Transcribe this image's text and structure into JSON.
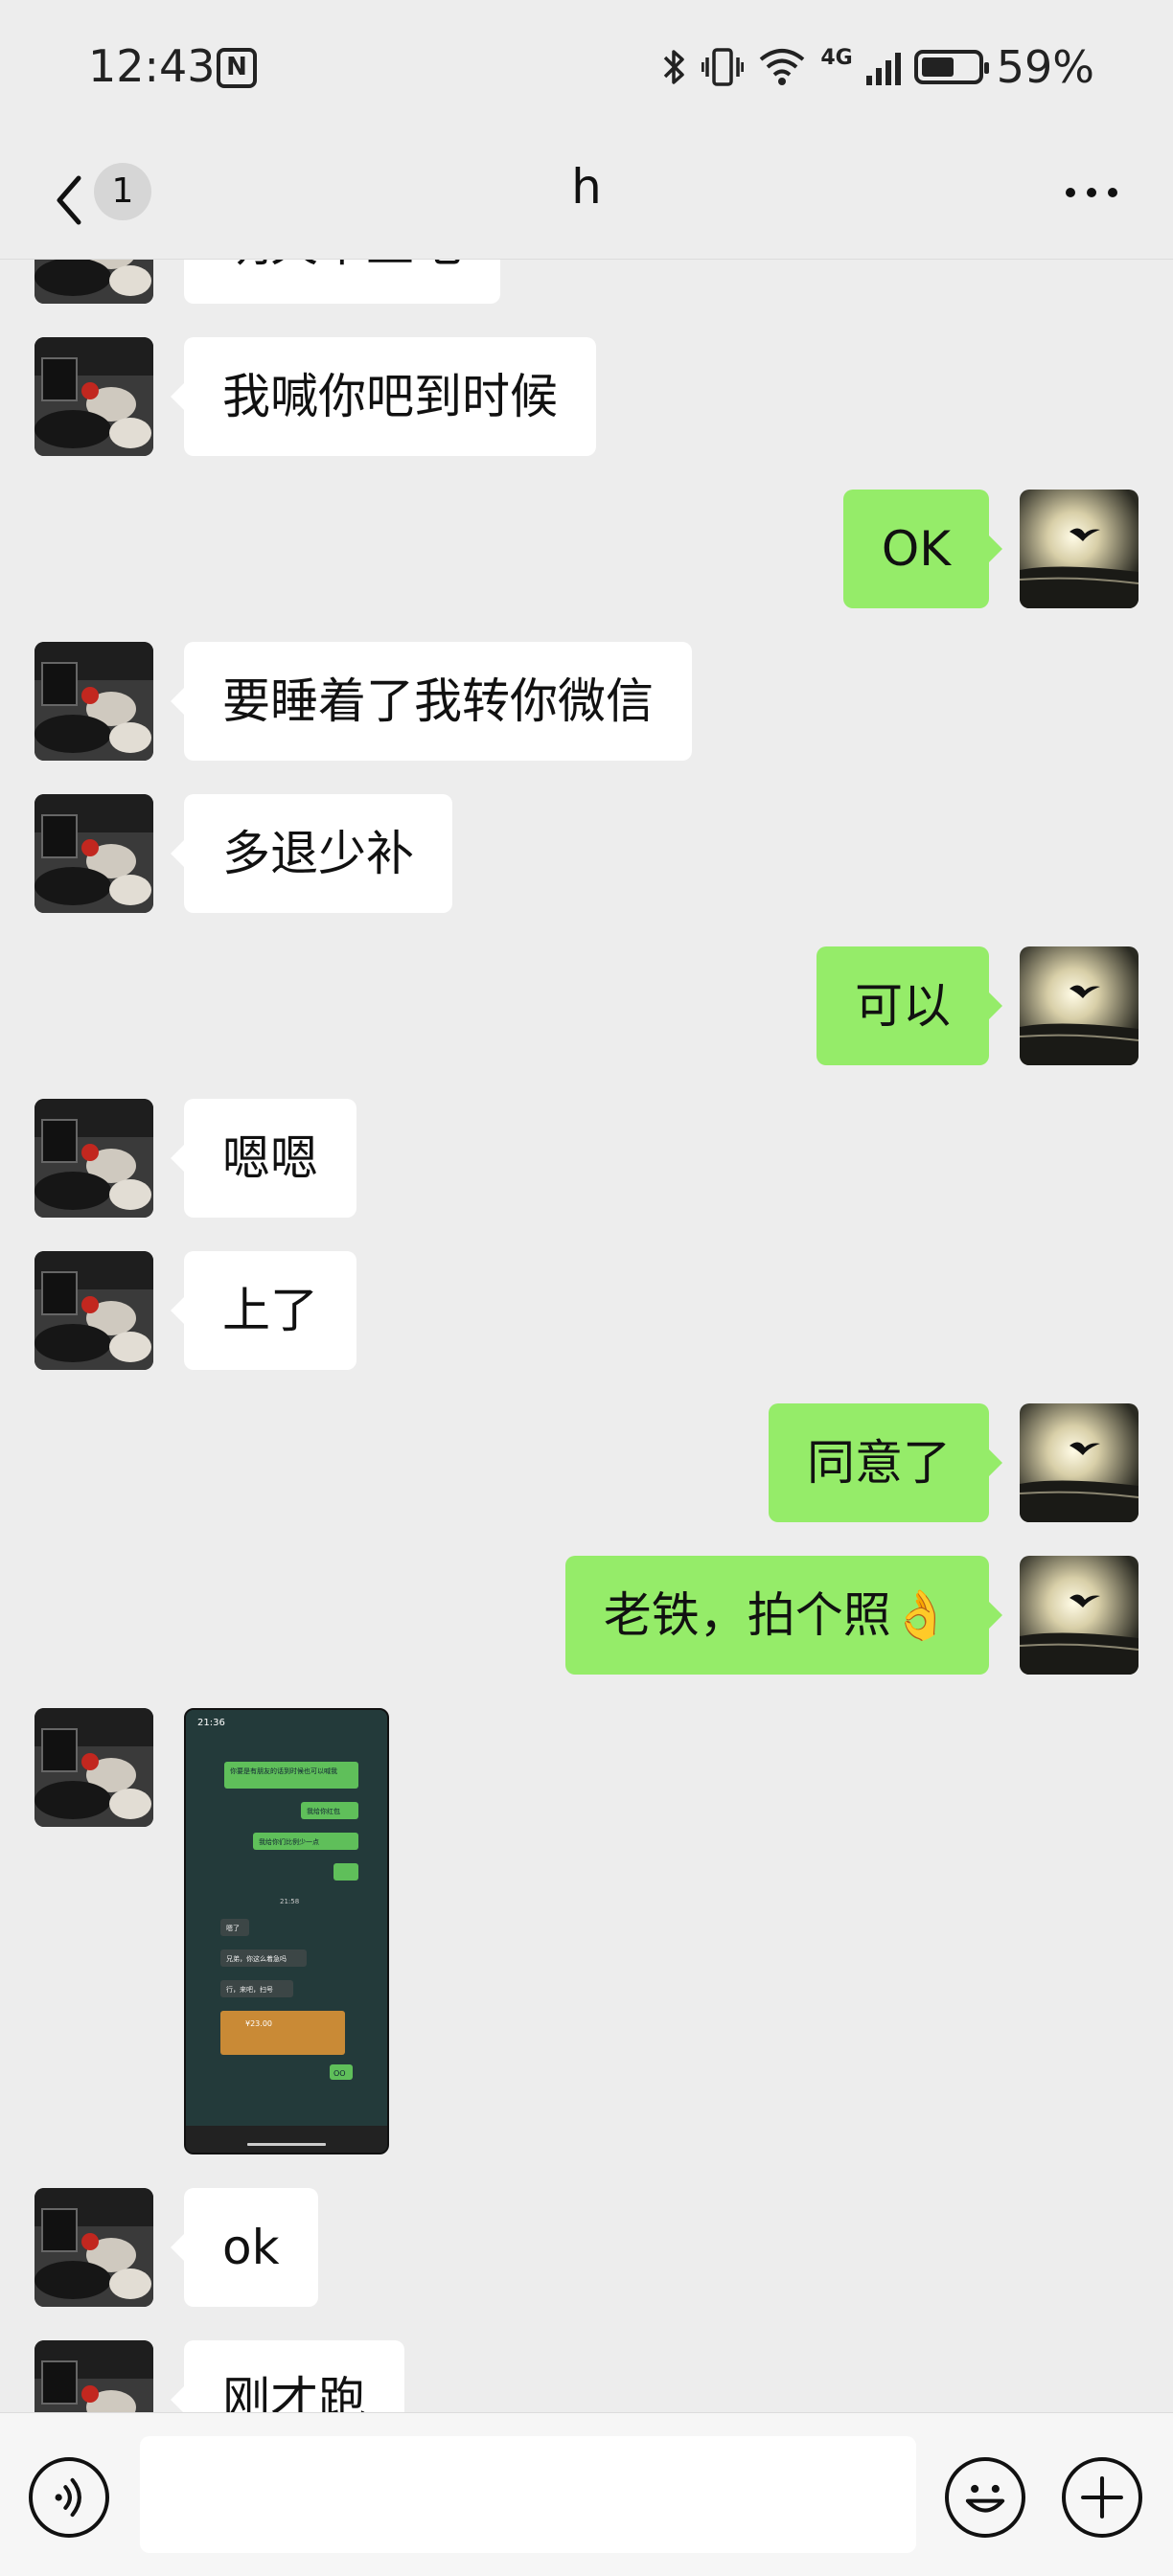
{
  "status_bar": {
    "time": "12:43",
    "nfc_label": "N",
    "network_type": "4G",
    "battery_percent": "59%",
    "battery_level": 0.59,
    "icons": [
      "bluetooth-icon",
      "vibrate-icon",
      "wifi-icon",
      "cellular-signal-icon",
      "battery-icon"
    ]
  },
  "nav": {
    "unread_count": "1",
    "title": "h",
    "back_icon": "chevron-left-icon",
    "more_icon": "more-dots-icon"
  },
  "messages": [
    {
      "side": "left",
      "text": "明天早上吧"
    },
    {
      "side": "left",
      "text": "我喊你吧到时候"
    },
    {
      "side": "right",
      "text": "OK"
    },
    {
      "side": "left",
      "text": "要睡着了我转你微信"
    },
    {
      "side": "left",
      "text": "多退少补"
    },
    {
      "side": "right",
      "text": "可以"
    },
    {
      "side": "left",
      "text": "嗯嗯"
    },
    {
      "side": "left",
      "text": "上了"
    },
    {
      "side": "right",
      "text": "同意了"
    },
    {
      "side": "right",
      "text": "老铁，拍个照👌"
    },
    {
      "side": "left",
      "type": "image",
      "text": ""
    },
    {
      "side": "left",
      "text": "ok"
    },
    {
      "side": "left",
      "text": "刚才跑"
    }
  ],
  "screenshot_thumb": {
    "time": "21:36",
    "lines": [
      "你要是有朋友的话到时候也可以喊我",
      "我给你红包",
      "我给你们比例少一点",
      "21:58",
      "嗯了",
      "兄弟，你这么着急吗",
      "行，来吧，扫号",
      "¥23.00",
      "OO"
    ]
  },
  "input_bar": {
    "voice_icon": "voice-icon",
    "emoji_icon": "emoji-icon",
    "plus_icon": "plus-icon",
    "placeholder": ""
  },
  "colors": {
    "background": "#ededed",
    "sent_bubble": "#95ec69",
    "received_bubble": "#ffffff"
  }
}
